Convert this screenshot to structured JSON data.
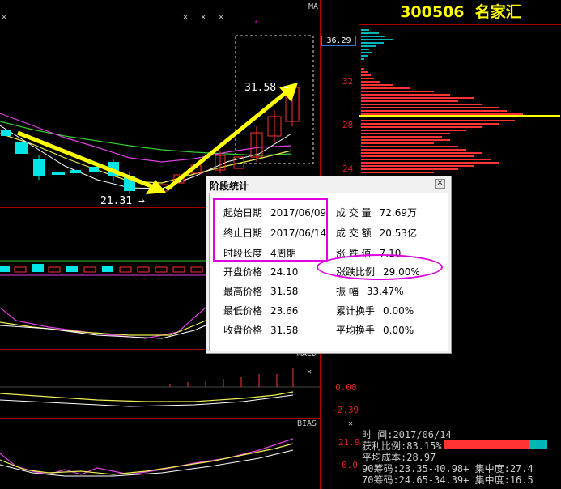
{
  "stock": {
    "code": "300506",
    "name": "名家汇"
  },
  "axis_labels": {
    "ma_label": "MA",
    "price_current": "36.29",
    "price_32": "32",
    "price_28": "28",
    "price_24": "24",
    "macd_label": "MACD",
    "macd_0": "0.00",
    "macd_neg": "-2.39",
    "bias_label": "BIAS",
    "bias_top": "21.9",
    "bias_0": "0.0"
  },
  "annotations": {
    "low_price": "21.31",
    "high_price": "31.58"
  },
  "dialog": {
    "title": "阶段统计",
    "close_glyph": "✕",
    "left": [
      {
        "key": "起始日期",
        "value": "2017/06/09"
      },
      {
        "key": "终止日期",
        "value": "2017/06/14"
      },
      {
        "key": "时段长度",
        "value": "4周期"
      },
      {
        "key": "开盘价格",
        "value": "24.10"
      },
      {
        "key": "最高价格",
        "value": "31.58"
      },
      {
        "key": "最低价格",
        "value": "23.66"
      },
      {
        "key": "收盘价格",
        "value": "31.58"
      }
    ],
    "right": [
      {
        "key": "成 交 量",
        "value": "72.69万"
      },
      {
        "key": "成 交 额",
        "value": "20.53亿"
      },
      {
        "key": "涨 跌 值",
        "value": "7.10"
      },
      {
        "key": "涨跌比例",
        "value": "29.00%"
      },
      {
        "key": "振    幅",
        "value": "33.47%"
      },
      {
        "key": "累计换手",
        "value": "0.00%"
      },
      {
        "key": "平均换手",
        "value": "0.00%"
      }
    ]
  },
  "chip_info": {
    "time": "时      间:2017/06/14",
    "profit_ratio": "获利比例:83.15%",
    "avg_cost": "平均成本:28.97",
    "chip90": "90筹码:23.35-40.98+ 集中度:27.4",
    "chip70": "70筹码:24.65-34.39+ 集中度:16.5",
    "profit_ratio_value": 0.8315
  },
  "colors": {
    "up": "#ff3333",
    "down": "#00e5e5",
    "accent_yellow": "#ffff00",
    "highlight_magenta": "#e000e0",
    "grid_red": "#aa0000"
  }
}
